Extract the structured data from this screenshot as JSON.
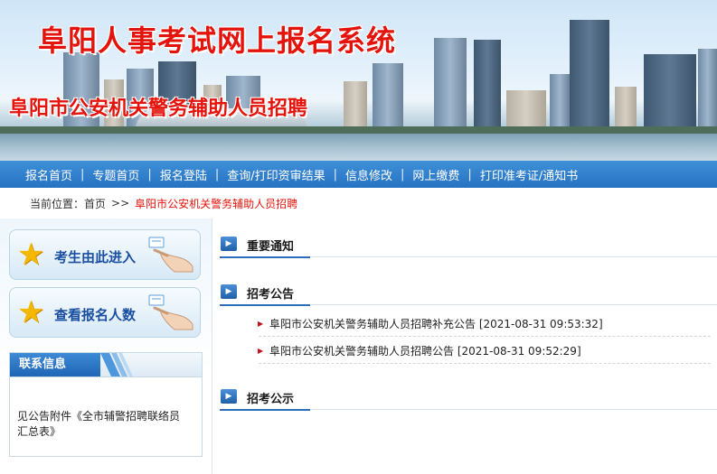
{
  "banner": {
    "title": "阜阳人事考试网上报名系统",
    "subtitle": "阜阳市公安机关警务辅助人员招聘"
  },
  "nav": {
    "items": [
      "报名首页",
      "专题首页",
      "报名登陆",
      "查询/打印资审结果",
      "信息修改",
      "网上缴费",
      "打印准考证/通知书"
    ],
    "separator": "|"
  },
  "breadcrumb": {
    "label": "当前位置：",
    "home": "首页",
    "arrow": ">>",
    "current": "阜阳市公安机关警务辅助人员招聘"
  },
  "sidebar": {
    "enter_button": "考生由此进入",
    "count_button": "查看报名人数",
    "contact": {
      "title": "联系信息",
      "text": "见公告附件《全市辅警招聘联络员汇总表》"
    }
  },
  "main": {
    "sections": [
      {
        "title": "重要通知"
      },
      {
        "title": "招考公告"
      },
      {
        "title": "招考公示"
      }
    ],
    "notices": [
      {
        "text": "阜阳市公安机关警务辅助人员招聘补充公告 [2021-08-31 09:53:32]"
      },
      {
        "text": "阜阳市公安机关警务辅助人员招聘公告 [2021-08-31 09:52:29]"
      }
    ]
  },
  "colors": {
    "brand_red": "#e4140c",
    "nav_blue": "#2673c2",
    "section_blue": "#1f5fa8"
  },
  "icons": {
    "section": "arrow-right-icon",
    "bullet": "triangle-right-icon",
    "star": "star-icon",
    "hand": "pointing-hand-icon"
  }
}
